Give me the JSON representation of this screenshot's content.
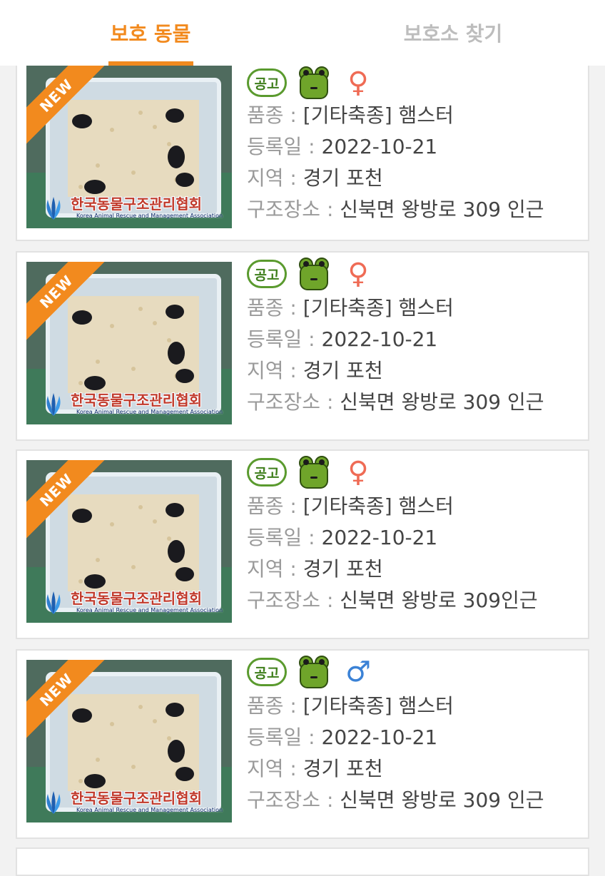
{
  "tabs": {
    "animals": "보호 동물",
    "shelter": "보호소 찾기"
  },
  "colors": {
    "accent": "#f28a1e",
    "female": "#ef6b55",
    "male": "#3b82d6",
    "badge_green": "#5a9a2e"
  },
  "labels": {
    "breed": "품종",
    "date": "등록일",
    "region": "지역",
    "place": "구조장소",
    "sep": " : "
  },
  "watermark": {
    "title": "한국동물구조관리협회",
    "subtitle": "Korea Animal Rescue and Management Association"
  },
  "cards": [
    {
      "new_badge": "NEW",
      "notice_badge": "공고",
      "status_icon": "frog-icon",
      "gender_symbol": "♀",
      "gender": "female",
      "breed": "[기타축종] 햄스터",
      "date": "2022-10-21",
      "region": "경기 포천",
      "place": "신북면 왕방로 309 인근"
    },
    {
      "new_badge": "NEW",
      "notice_badge": "공고",
      "status_icon": "frog-icon",
      "gender_symbol": "♀",
      "gender": "female",
      "breed": "[기타축종] 햄스터",
      "date": "2022-10-21",
      "region": "경기 포천",
      "place": "신북면 왕방로 309 인근"
    },
    {
      "new_badge": "NEW",
      "notice_badge": "공고",
      "status_icon": "frog-icon",
      "gender_symbol": "♀",
      "gender": "female",
      "breed": "[기타축종] 햄스터",
      "date": "2022-10-21",
      "region": "경기 포천",
      "place": "신북면 왕방로 309인근"
    },
    {
      "new_badge": "NEW",
      "notice_badge": "공고",
      "status_icon": "frog-icon",
      "gender_symbol": "♂",
      "gender": "male",
      "breed": "[기타축종] 햄스터",
      "date": "2022-10-21",
      "region": "경기 포천",
      "place": "신북면 왕방로 309 인근"
    }
  ]
}
